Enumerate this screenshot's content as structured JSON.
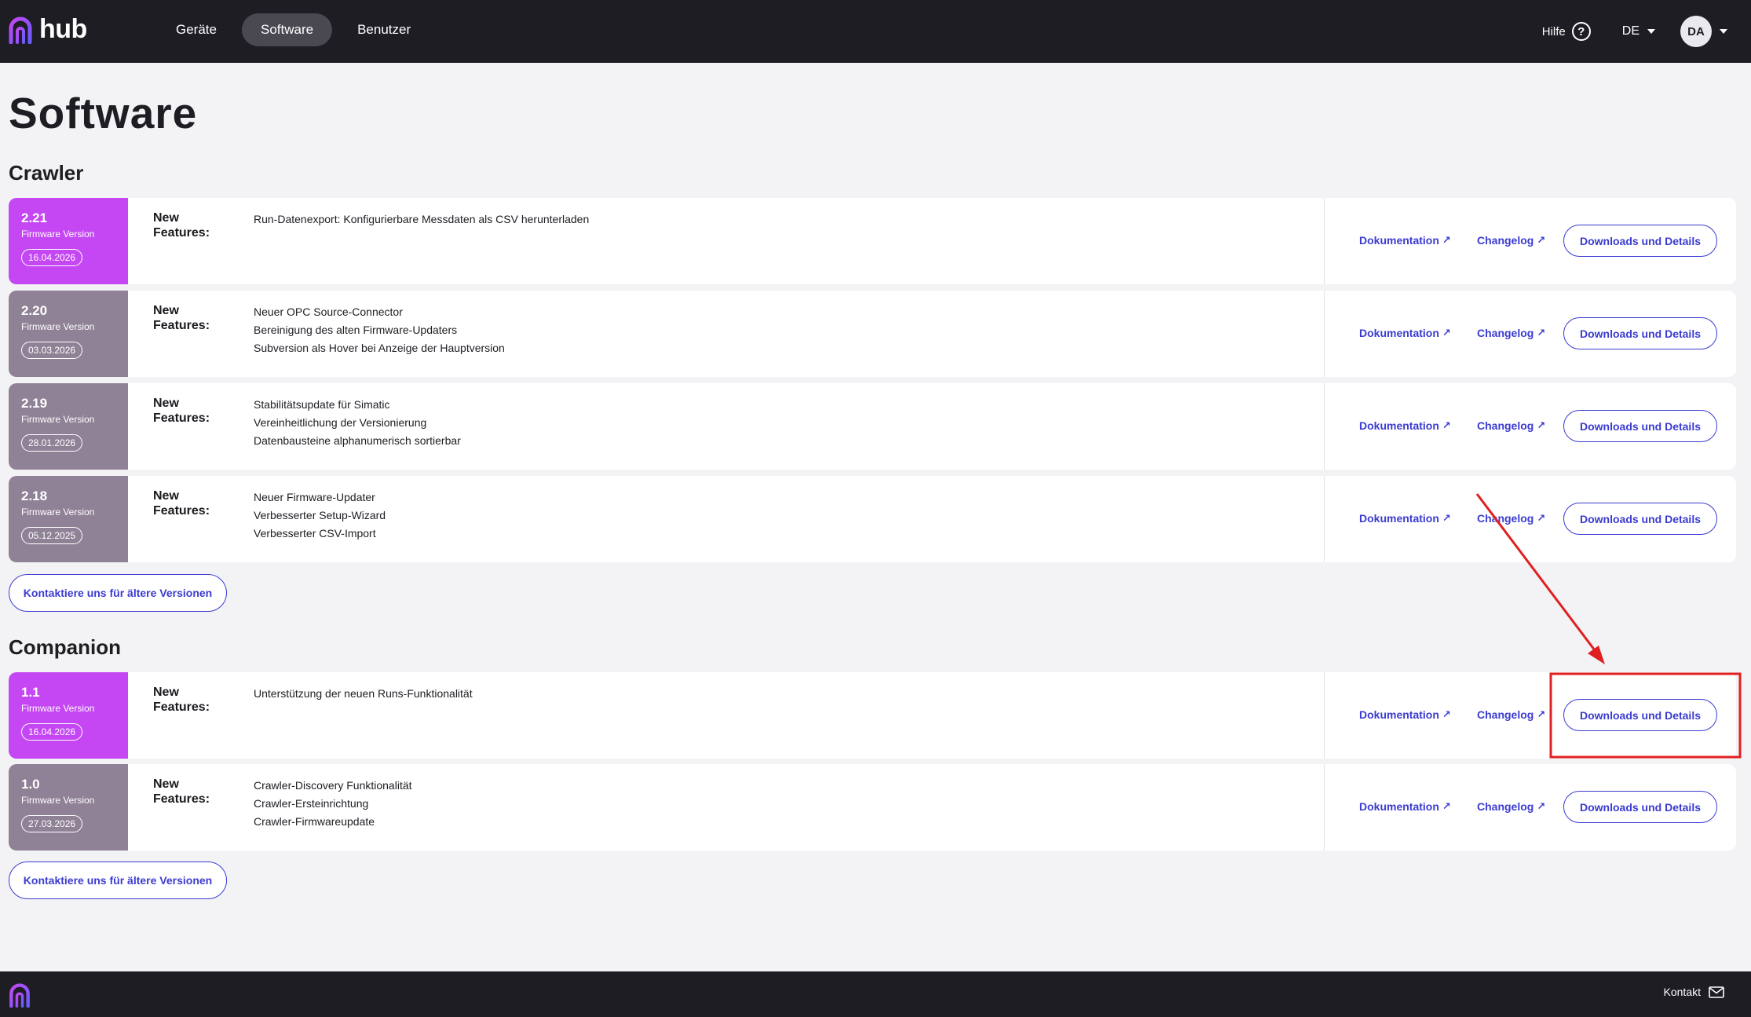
{
  "app": {
    "logo_text": "hub"
  },
  "nav": {
    "items": [
      {
        "label": "Geräte"
      },
      {
        "label": "Software",
        "active": true
      },
      {
        "label": "Benutzer"
      }
    ],
    "help_label": "Hilfe",
    "language": "DE",
    "avatar_initials": "DA"
  },
  "page_title": "Software",
  "sections": [
    {
      "title": "Crawler",
      "releases": [
        {
          "version": "2.21",
          "version_label": "Firmware Version",
          "date": "16.04.2026",
          "current": true,
          "features_label": "New Features:",
          "features": [
            "Run-Datenexport: Konfigurierbare Messdaten als CSV herunterladen"
          ]
        },
        {
          "version": "2.20",
          "version_label": "Firmware Version",
          "date": "03.03.2026",
          "current": false,
          "features_label": "New Features:",
          "features": [
            "Neuer OPC Source-Connector",
            "Bereinigung des alten Firmware-Updaters",
            "Subversion als Hover bei Anzeige der Hauptversion"
          ]
        },
        {
          "version": "2.19",
          "version_label": "Firmware Version",
          "date": "28.01.2026",
          "current": false,
          "features_label": "New Features:",
          "features": [
            "Stabilitätsupdate für Simatic",
            "Vereinheitlichung der Versionierung",
            "Datenbausteine alphanumerisch sortierbar"
          ]
        },
        {
          "version": "2.18",
          "version_label": "Firmware Version",
          "date": "05.12.2025",
          "current": false,
          "features_label": "New Features:",
          "features": [
            "Neuer Firmware-Updater",
            "Verbesserter Setup-Wizard",
            "Verbesserter CSV-Import"
          ]
        }
      ],
      "contact_label": "Kontaktiere uns für ältere Versionen"
    },
    {
      "title": "Companion",
      "releases": [
        {
          "version": "1.1",
          "version_label": "Firmware Version",
          "date": "16.04.2026",
          "current": true,
          "features_label": "New Features:",
          "features": [
            "Unterstützung der neuen Runs-Funktionalität"
          ]
        },
        {
          "version": "1.0",
          "version_label": "Firmware Version",
          "date": "27.03.2026",
          "current": false,
          "features_label": "New Features:",
          "features": [
            "Crawler-Discovery Funktionalität",
            "Crawler-Ersteinrichtung",
            "Crawler-Firmwareupdate"
          ]
        }
      ],
      "contact_label": "Kontaktiere uns für ältere Versionen"
    }
  ],
  "actions": {
    "documentation": "Dokumentation",
    "changelog": "Changelog",
    "downloads": "Downloads und Details",
    "external_arrow": "↗"
  },
  "footer": {
    "contact_label": "Kontakt"
  },
  "colors": {
    "topbar": "#1d1d23",
    "accent": "#3b3bd1",
    "current_version": "#c447f3",
    "old_version": "#8f8196",
    "annotation": "#e02020"
  }
}
